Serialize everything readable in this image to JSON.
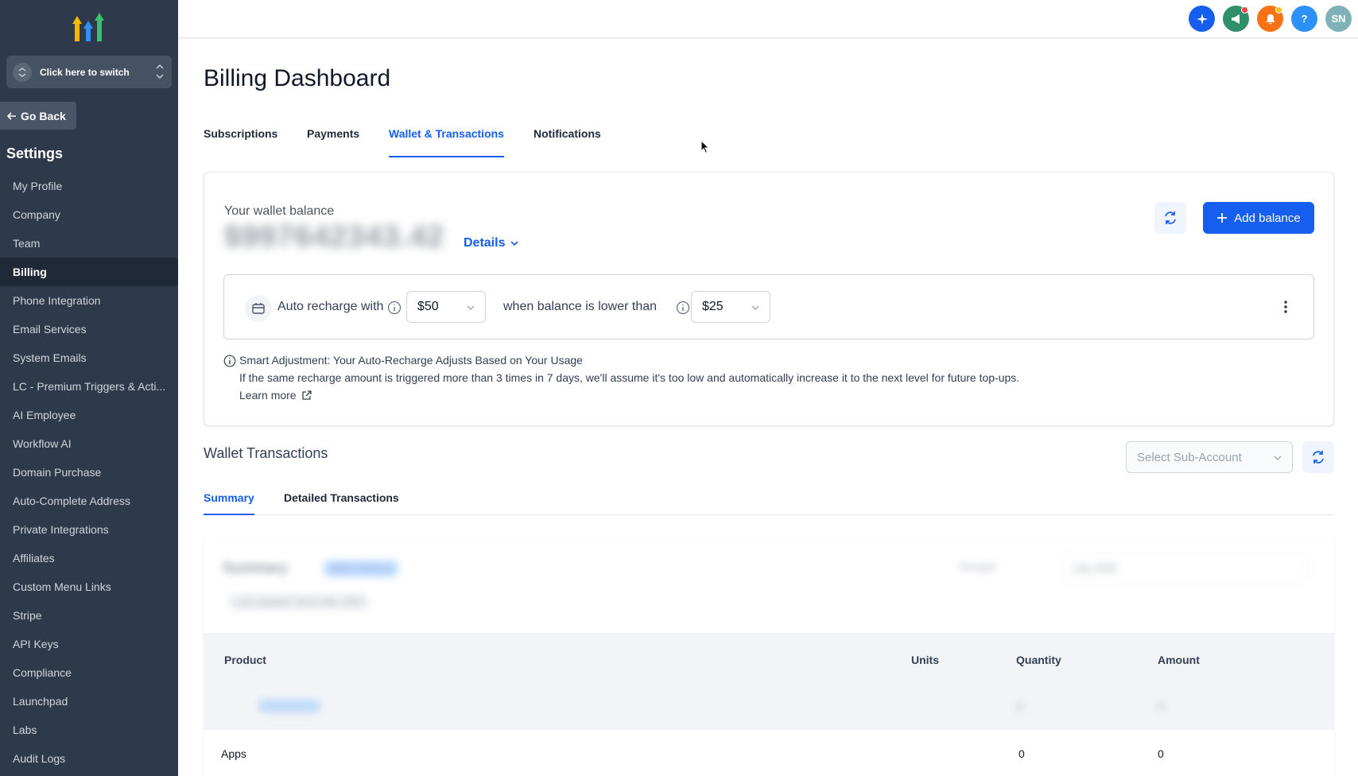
{
  "sidebar": {
    "switcher_label": "Click here to switch",
    "go_back": "Go Back",
    "section_title": "Settings",
    "items": [
      {
        "label": "My Profile",
        "name": "my-profile"
      },
      {
        "label": "Company",
        "name": "company"
      },
      {
        "label": "Team",
        "name": "team"
      },
      {
        "label": "Billing",
        "name": "billing",
        "active": true
      },
      {
        "label": "Phone Integration",
        "name": "phone-integration"
      },
      {
        "label": "Email Services",
        "name": "email-services"
      },
      {
        "label": "System Emails",
        "name": "system-emails"
      },
      {
        "label": "LC - Premium Triggers & Acti...",
        "name": "lc-premium-triggers"
      },
      {
        "label": "AI Employee",
        "name": "ai-employee"
      },
      {
        "label": "Workflow AI",
        "name": "workflow-ai"
      },
      {
        "label": "Domain Purchase",
        "name": "domain-purchase"
      },
      {
        "label": "Auto-Complete Address",
        "name": "auto-complete-address"
      },
      {
        "label": "Private Integrations",
        "name": "private-integrations"
      },
      {
        "label": "Affiliates",
        "name": "affiliates"
      },
      {
        "label": "Custom Menu Links",
        "name": "custom-menu-links"
      },
      {
        "label": "Stripe",
        "name": "stripe"
      },
      {
        "label": "API Keys",
        "name": "api-keys"
      },
      {
        "label": "Compliance",
        "name": "compliance"
      },
      {
        "label": "Launchpad",
        "name": "launchpad"
      },
      {
        "label": "Labs",
        "name": "labs"
      },
      {
        "label": "Audit Logs",
        "name": "audit-logs"
      }
    ]
  },
  "topbar": {
    "avatar_initials": "SN",
    "help_glyph": "?",
    "icons": [
      "sparkle-icon",
      "megaphone-icon",
      "bell-icon",
      "help-icon",
      "avatar"
    ],
    "colors": {
      "sparkle": "#155eef",
      "megaphone": "#2f8f6b",
      "bell": "#f97316",
      "help": "#2e90fa",
      "avatar": "#7fb2b8"
    }
  },
  "page": {
    "title": "Billing Dashboard",
    "tabs": [
      "Subscriptions",
      "Payments",
      "Wallet & Transactions",
      "Notifications"
    ],
    "active_tab": "Wallet & Transactions"
  },
  "wallet": {
    "label": "Your wallet balance",
    "balance": "$997642343.42",
    "details_link": "Details",
    "add_balance": "Add balance",
    "recharge": {
      "prefix": "Auto recharge with",
      "amount": "$50",
      "middle": "when balance is lower than",
      "threshold": "$25"
    },
    "smart": {
      "title": "Smart Adjustment: Your Auto-Recharge Adjusts Based on Your Usage",
      "body": "If the same recharge amount is triggered more than 3 times in 7 days, we'll assume it's too low and automatically increase it to the next level for future top-ups.",
      "learn_more": "Learn more"
    }
  },
  "transactions": {
    "title": "Wallet Transactions",
    "subaccount_placeholder": "Select Sub-Account",
    "subtabs": [
      "Summary",
      "Detailed Transactions"
    ],
    "active_subtab": "Summary",
    "summary_card": {
      "heading": "Summary",
      "badge": "Wallet Balance",
      "last_updated": "Last updated: 09:41 AM, 2025",
      "toggle_label": "Grouped",
      "month_select": "July 2025"
    },
    "columns": [
      "Product",
      "Units",
      "Quantity",
      "Amount"
    ],
    "rows": [
      {
        "product": "",
        "units": "",
        "quantity": "0",
        "amount": "0"
      },
      {
        "product": "Apps",
        "units": "",
        "quantity": "0",
        "amount": "0"
      }
    ]
  },
  "accent": "#155eef"
}
